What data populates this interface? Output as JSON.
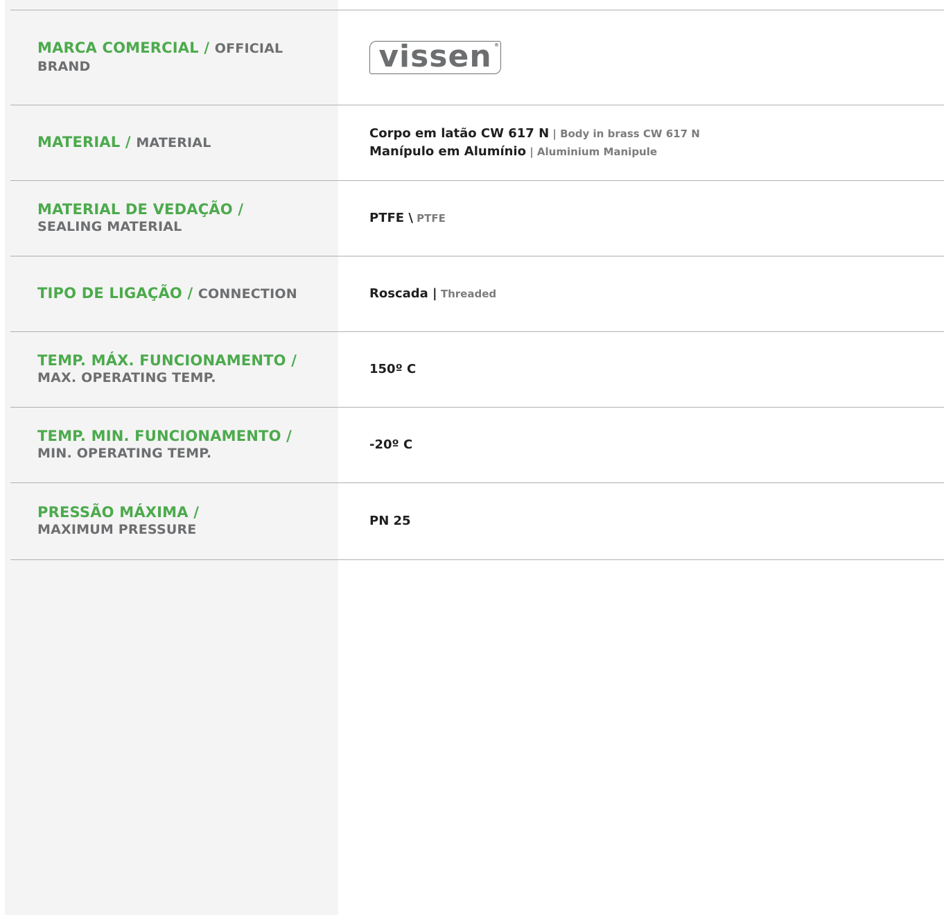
{
  "rows": [
    {
      "label_pt": "MARCA COMERCIAL /",
      "label_en": "OFFICIAL BRAND",
      "logo_text": "vissen",
      "logo_reg": "®"
    },
    {
      "label_pt": "MATERIAL /",
      "label_en": "MATERIAL",
      "value_lines": [
        {
          "main": "Corpo em latão CW 617 N",
          "sub": " | Body in brass CW 617 N"
        },
        {
          "main": "Manípulo em Alumínio",
          "sub": " | Aluminium Manipule"
        }
      ]
    },
    {
      "label_pt": "MATERIAL  DE VEDAÇÃO /",
      "label_en": "SEALING MATERIAL",
      "value_main": "PTFE \\",
      "value_sub": " PTFE"
    },
    {
      "label_pt": "TIPO DE LIGAÇÃO /",
      "label_en": "CONNECTION",
      "value_main": "Roscada |",
      "value_sub": " Threaded"
    },
    {
      "label_pt": "TEMP. MÁX. FUNCIONAMENTO /",
      "label_en": " MAX. OPERATING TEMP.",
      "value_main": "150º C"
    },
    {
      "label_pt": "TEMP. MIN. FUNCIONAMENTO /",
      "label_en": "MIN. OPERATING TEMP.",
      "value_main": "-20º C"
    },
    {
      "label_pt": "PRESSÃO MÁXIMA /",
      "label_en": "MAXIMUM PRESSURE",
      "value_main": "PN 25"
    }
  ],
  "colors": {
    "label_pt": "#4caa4c",
    "label_en": "#6d6e70",
    "left_panel": "#f4f4f4",
    "divider": "#b0b0b0"
  }
}
